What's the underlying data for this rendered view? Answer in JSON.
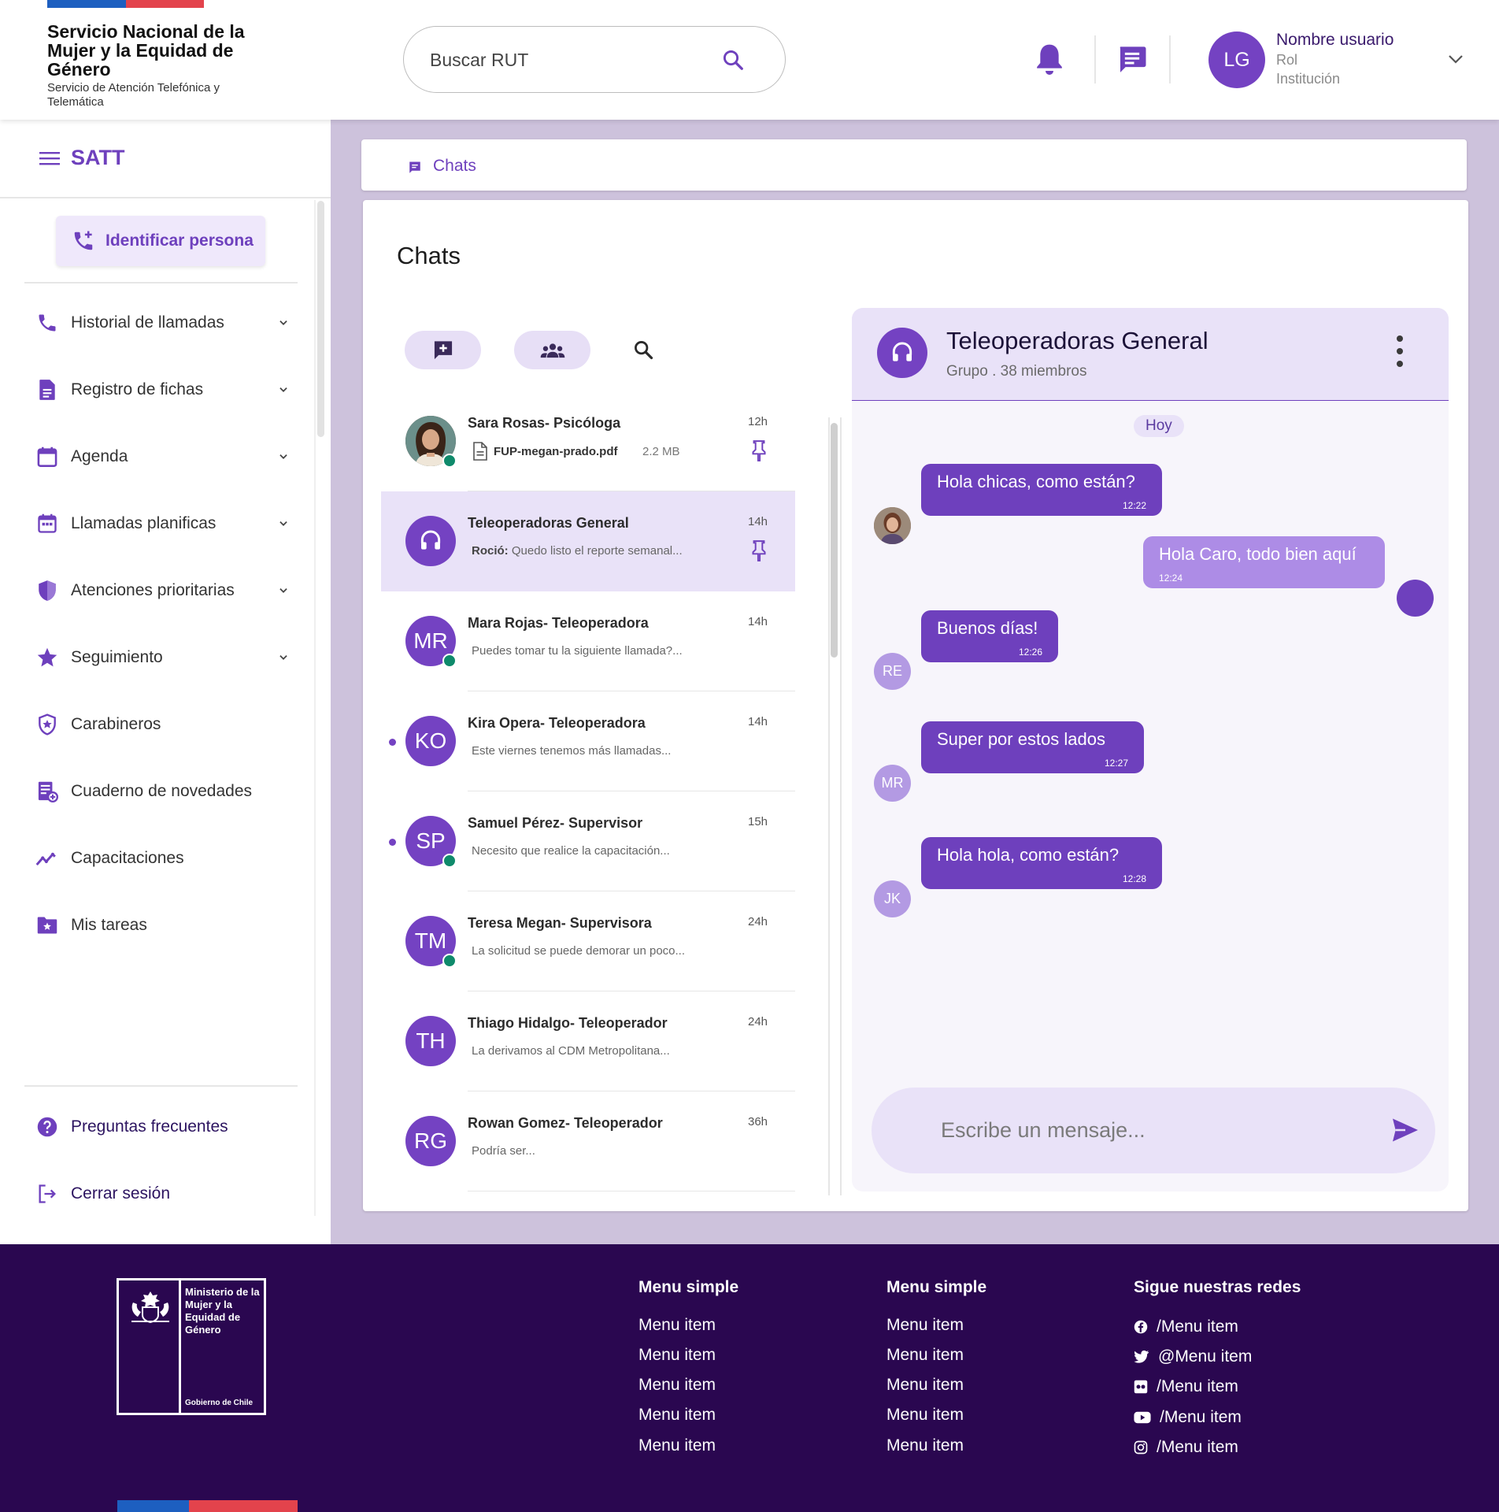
{
  "header": {
    "org_name": "Servicio Nacional de la Mujer y la Equidad de Género",
    "org_sub": "Servicio de Atención Telefónica y Telemática",
    "search_placeholder": "Buscar RUT",
    "user": {
      "initials": "LG",
      "name": "Nombre usuario",
      "role": "Rol",
      "institution": "Institución"
    }
  },
  "sidebar": {
    "app_name": "SATT",
    "identify_label": "Identificar persona",
    "items": [
      {
        "label": "Historial de llamadas",
        "icon": "phone-icon",
        "has_submenu": true
      },
      {
        "label": "Registro de fichas",
        "icon": "document-icon",
        "has_submenu": true
      },
      {
        "label": "Agenda",
        "icon": "calendar-icon",
        "has_submenu": true
      },
      {
        "label": "Llamadas planificas",
        "icon": "calendar-scheduled-icon",
        "has_submenu": true
      },
      {
        "label": "Atenciones prioritarias",
        "icon": "shield-icon",
        "has_submenu": true
      },
      {
        "label": "Seguimiento",
        "icon": "star-icon",
        "has_submenu": true
      },
      {
        "label": "Carabineros",
        "icon": "badge-shield-icon",
        "has_submenu": false
      },
      {
        "label": "Cuaderno de novedades",
        "icon": "notebook-icon",
        "has_submenu": false
      },
      {
        "label": "Capacitaciones",
        "icon": "trending-icon",
        "has_submenu": false
      },
      {
        "label": "Mis tareas",
        "icon": "folder-star-icon",
        "has_submenu": false
      }
    ],
    "bottom": [
      {
        "label": "Preguntas frecuentes",
        "icon": "help-icon"
      },
      {
        "label": "Cerrar sesión",
        "icon": "logout-icon"
      }
    ]
  },
  "breadcrumb": {
    "label": "Chats"
  },
  "main": {
    "title": "Chats",
    "chats": [
      {
        "name": "Sara Rosas- Psicóloga",
        "time": "12h",
        "file_name": "FUP-megan-prado.pdf",
        "file_size": "2.2 MB",
        "photo": true,
        "online": true,
        "pinned": true
      },
      {
        "name": "Teleoperadoras General",
        "time": "14h",
        "sender": "Roció:",
        "message": "Quedo listo el reporte semanal...",
        "group": true,
        "pinned": true,
        "active": true
      },
      {
        "name": "Mara Rojas- Teleoperadora",
        "time": "14h",
        "initials": "MR",
        "message": "Puedes tomar tu la siguiente llamada?...",
        "online": true
      },
      {
        "name": "Kira Opera- Teleoperadora",
        "time": "14h",
        "initials": "KO",
        "message": "Este viernes tenemos más llamadas...",
        "unread": true
      },
      {
        "name": "Samuel Pérez- Supervisor",
        "time": "15h",
        "initials": "SP",
        "message": "Necesito que realice la capacitación...",
        "online": true,
        "unread": true
      },
      {
        "name": "Teresa Megan- Supervisora",
        "time": "24h",
        "initials": "TM",
        "message": "La solicitud se puede demorar un poco...",
        "online": true
      },
      {
        "name": "Thiago Hidalgo- Teleoperador",
        "time": "24h",
        "initials": "TH",
        "message": "La derivamos al CDM Metropolitana..."
      },
      {
        "name": "Rowan Gomez- Teleoperador",
        "time": "36h",
        "initials": "RG",
        "message": "Podría ser..."
      }
    ]
  },
  "conversation": {
    "title": "Teleoperadoras General",
    "subtitle": "Grupo . 38 miembros",
    "day": "Hoy",
    "messages": [
      {
        "text": "Hola chicas, como están?",
        "time": "12:22",
        "own": false
      },
      {
        "text": "Hola Caro, todo bien aquí",
        "time": "12:24",
        "own": true
      },
      {
        "text": "Buenos días!",
        "time": "12:26",
        "own": false,
        "initials": "RE"
      },
      {
        "text": "Super por estos lados",
        "time": "12:27",
        "own": false,
        "initials": "MR"
      },
      {
        "text": "Hola hola, como están?",
        "time": "12:28",
        "own": false,
        "initials": "JK"
      }
    ],
    "composer_placeholder": "Escribe un mensaje..."
  },
  "footer": {
    "ministry": "Ministerio de la Mujer y la Equidad de Género",
    "gov": "Gobierno de Chile",
    "col1": {
      "title": "Menu simple",
      "items": [
        "Menu item",
        "Menu item",
        "Menu item",
        "Menu item",
        "Menu item"
      ]
    },
    "col2": {
      "title": "Menu simple",
      "items": [
        "Menu item",
        "Menu item",
        "Menu item",
        "Menu item",
        "Menu item"
      ]
    },
    "social": {
      "title": "Sigue nuestras redes",
      "items": [
        {
          "icon": "facebook-icon",
          "label": "/Menu item"
        },
        {
          "icon": "twitter-icon",
          "label": "@Menu item"
        },
        {
          "icon": "flickr-icon",
          "label": "/Menu item"
        },
        {
          "icon": "youtube-icon",
          "label": "/Menu item"
        },
        {
          "icon": "instagram-icon",
          "label": "/Menu item"
        }
      ]
    }
  },
  "colors": {
    "primary": "#6e40bd",
    "primary_light": "#e9e2f8",
    "online": "#0f8a6b",
    "footer": "#2a0750",
    "background": "#cdc2dc"
  }
}
